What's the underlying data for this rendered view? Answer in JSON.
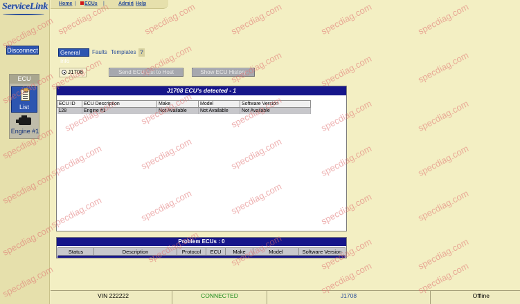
{
  "app": {
    "logo_text": "ServiceLink"
  },
  "nav": {
    "home": "Home",
    "ecus": "ECUs",
    "admin": "Admin",
    "help": "Help",
    "sep": "|"
  },
  "left": {
    "disconnect": "Disconnect",
    "ecu_title": "ECU",
    "list_label": "List",
    "engine_label": "Engine #1"
  },
  "tabs": {
    "general": "General Info",
    "faults": "Faults",
    "templates": "Templates",
    "help": "?"
  },
  "controls": {
    "protocol_radio": "J1708",
    "send_button": "Send ECU List to Host",
    "history_button": "Show ECU History"
  },
  "ecu_panel": {
    "header": "J1708 ECU's detected - 1",
    "columns": [
      "ECU ID",
      "ECU Description",
      "Make",
      "Model",
      "Software Version"
    ],
    "rows": [
      [
        "128",
        "Engine #1",
        "Not Available",
        "Not Available",
        "Not Available"
      ]
    ]
  },
  "problem_panel": {
    "header": "Problem ECUs : 0",
    "columns": [
      "Status",
      "Description",
      "Protocol",
      "ECU",
      "Make",
      "Model",
      "Software Version"
    ]
  },
  "status_bar": {
    "vin": "VIN 222222",
    "connection": "CONNECTED",
    "protocol": "J1708",
    "mode": "Offline"
  },
  "watermark": "specdiag.com",
  "colors": {
    "background": "#f3efc3",
    "accent_blue": "#2d55b0",
    "header_navy": "#16168a",
    "connected_green": "#178a17"
  }
}
